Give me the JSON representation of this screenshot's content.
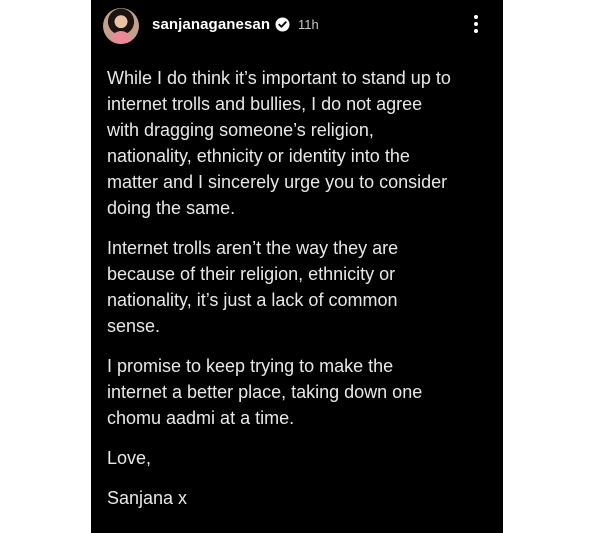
{
  "header": {
    "username": "sanjanaganesan",
    "time": "11h",
    "avatar_icon": "profile-avatar-icon",
    "verified_icon": "verified-badge-icon",
    "more_icon": "more-vertical-icon"
  },
  "post": {
    "paragraphs": [
      "While I do think it’s important to stand up to\ninternet trolls and bullies, I do not agree\nwith dragging someone’s religion,\nnationality, ethnicity or identity into the\nmatter and I sincerely urge you to consider\ndoing the same.",
      "Internet trolls aren’t the way they are\nbecause of their religion, ethnicity or\nnationality, it’s just a lack of common\nsense.",
      "I promise to keep trying to make the\ninternet a better place, taking down one\nchomu aadmi at a time.",
      "Love,",
      "Sanjana x"
    ]
  },
  "colors": {
    "background": "#000000",
    "text": "#e8e8e8",
    "verified": "#0095f6"
  }
}
